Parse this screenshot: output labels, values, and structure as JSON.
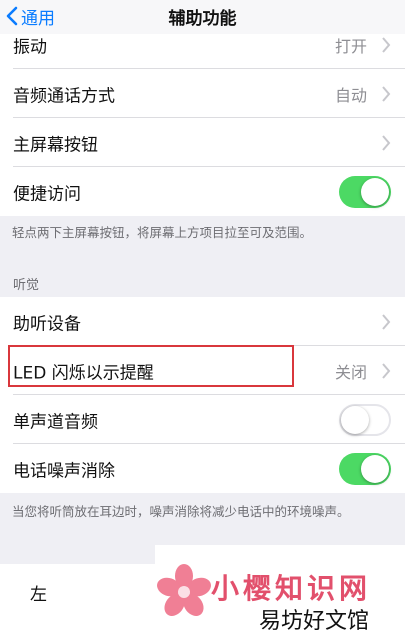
{
  "nav": {
    "back_label": "通用",
    "title": "辅助功能"
  },
  "group1": {
    "rows": [
      {
        "label": "振动",
        "value": "打开"
      },
      {
        "label": "音频通话方式",
        "value": "自动"
      },
      {
        "label": "主屏幕按钮"
      },
      {
        "label": "便捷访问",
        "toggle": "on"
      }
    ],
    "footnote": "轻点两下主屏幕按钮，将屏幕上方项目拉至可及范围。"
  },
  "hearing": {
    "header": "听觉",
    "rows": [
      {
        "label": "助听设备"
      },
      {
        "label": "LED 闪烁以示提醒",
        "value": "关闭"
      },
      {
        "label": "单声道音频",
        "toggle": "off"
      },
      {
        "label": "电话噪声消除",
        "toggle": "on"
      }
    ],
    "footnote": "当您将听筒放在耳边时，噪声消除将减少电话中的环境噪声。"
  },
  "balance": {
    "left_label": "左"
  },
  "watermark": {
    "line1": "小樱知识网",
    "line2": "易坊好文馆"
  },
  "colors": {
    "accent": "#0a7cff",
    "toggle_on": "#4cd964",
    "highlight": "#d9373c"
  }
}
